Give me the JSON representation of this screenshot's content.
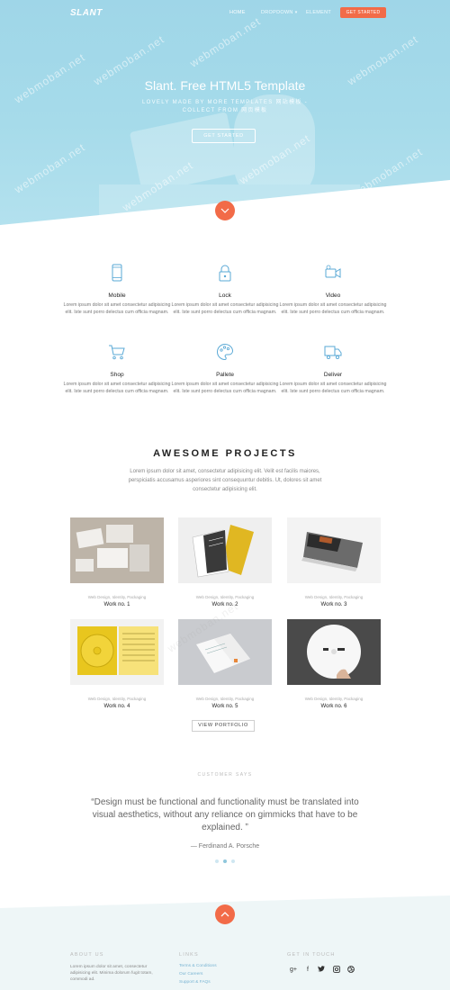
{
  "header": {
    "logo": "SLANT",
    "nav": [
      {
        "label": "HOME"
      },
      {
        "label": "DROPDOWN"
      },
      {
        "label": "ELEMENT"
      }
    ],
    "cta": "GET STARTED"
  },
  "hero": {
    "title": "Slant. Free HTML5 Template",
    "subtitle": "LOVELY MADE BY MORE TEMPLATES 网站模板 - COLLECT FROM 网页模板",
    "button": "GET STARTED"
  },
  "watermark": "webmoban.net",
  "services": [
    {
      "title": "Mobile",
      "text": "Lorem ipsum dolor sit amet consectetur adipisicing elit. Iste sunt porro delectus cum officia magnam.",
      "icon": "mobile-icon"
    },
    {
      "title": "Lock",
      "text": "Lorem ipsum dolor sit amet consectetur adipisicing elit. Iste sunt porro delectus cum officia magnam.",
      "icon": "lock-icon"
    },
    {
      "title": "Video",
      "text": "Lorem ipsum dolor sit amet consectetur adipisicing elit. Iste sunt porro delectus cum officia magnam.",
      "icon": "video-camera-icon"
    },
    {
      "title": "Shop",
      "text": "Lorem ipsum dolor sit amet consectetur adipisicing elit. Iste sunt porro delectus cum officia magnam.",
      "icon": "shopping-cart-icon"
    },
    {
      "title": "Pallete",
      "text": "Lorem ipsum dolor sit amet consectetur adipisicing elit. Iste sunt porro delectus cum officia magnam.",
      "icon": "palette-icon"
    },
    {
      "title": "Deliver",
      "text": "Lorem ipsum dolor sit amet consectetur adipisicing elit. Iste sunt porro delectus cum officia magnam.",
      "icon": "truck-icon"
    }
  ],
  "projects": {
    "title": "AWESOME PROJECTS",
    "intro": "Lorem ipsum dolor sit amet, consectetur adipisicing elit. Velit est facilis maiores, perspiciatis accusamus asperiores sint consequuntur debitis. Ut, dolores sit amet consectetur adipisicing elit.",
    "items": [
      {
        "category": "Web Design, Identity, Packaging",
        "name": "Work no. 1"
      },
      {
        "category": "Web Design, Identity, Packaging",
        "name": "Work no. 2"
      },
      {
        "category": "Web Design, Identity, Packaging",
        "name": "Work no. 3"
      },
      {
        "category": "Web Design, Identity, Packaging",
        "name": "Work no. 4"
      },
      {
        "category": "Web Design, Identity, Packaging",
        "name": "Work no. 5"
      },
      {
        "category": "Web Design, Identity, Packaging",
        "name": "Work no. 6"
      }
    ],
    "button": "VIEW PORTFOLIO"
  },
  "testimonial": {
    "eyebrow": "CUSTOMER SAYS",
    "quote": "“Design must be functional and functionality must be translated into visual aesthetics, without any reliance on gimmicks that have to be explained. ”",
    "author": "— Ferdinand A. Porsche"
  },
  "footer": {
    "about_heading": "ABOUT US",
    "about_text": "Lorem ipsum dolor sit amet, consectetur adipisicing elit. Minima dolorum fugit totam, commodi ad.",
    "links_heading": "LINKS",
    "links": [
      "Terms & Conditions",
      "Our Careers",
      "Support & FAQs"
    ],
    "touch_heading": "GET IN TOUCH",
    "social": [
      "google-plus-icon",
      "facebook-icon",
      "twitter-icon",
      "instagram-icon",
      "dribbble-icon"
    ]
  },
  "colors": {
    "accent": "#f26b48",
    "hero_blue": "#a6dbea",
    "footer_bg": "#eef6f7"
  }
}
